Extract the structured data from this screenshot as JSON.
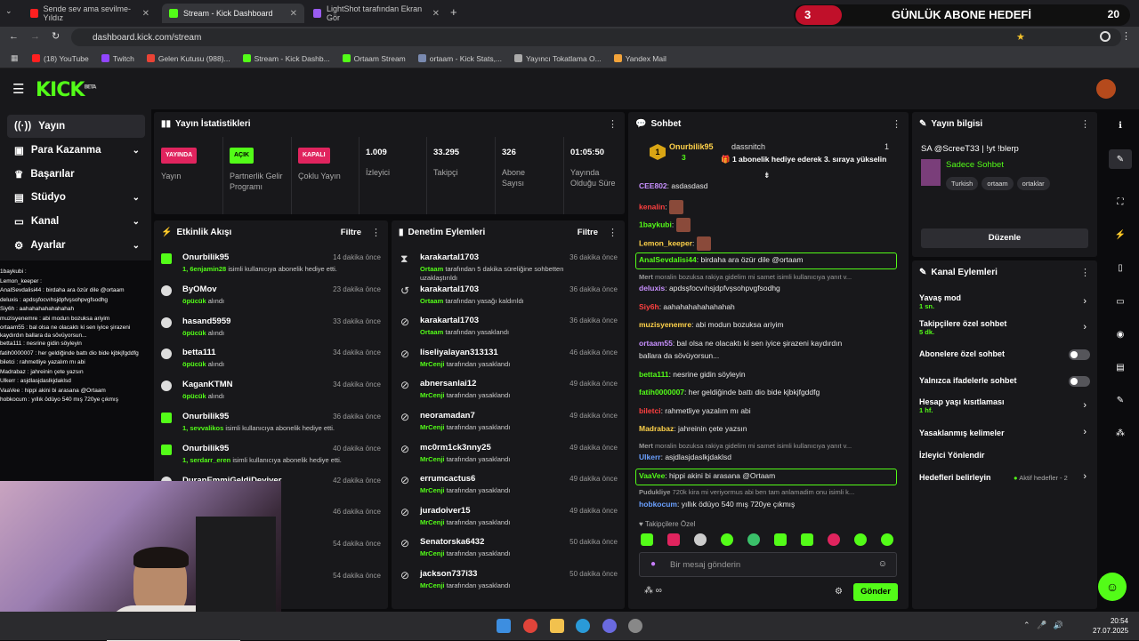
{
  "browser": {
    "tabs": [
      {
        "label": "Sende sev ama sevilme- Yıldız",
        "active": false
      },
      {
        "label": "Stream - Kick Dashboard",
        "active": true
      },
      {
        "label": "LightShot tarafından Ekran Gör",
        "active": false
      }
    ],
    "url": "dashboard.kick.com/stream",
    "bookmarks": [
      "(18) YouTube",
      "Twitch",
      "Gelen Kutusu (988)...",
      "Stream - Kick Dashb...",
      "Ortaam Stream",
      "ortaam - Kick Stats,...",
      "Yayıncı Tokatlama O...",
      "Yandex Mail"
    ]
  },
  "sub_goal": {
    "count": "3",
    "label": "GÜNLÜK ABONE HEDEFİ",
    "target": "20"
  },
  "kick": {
    "logo": "KICK",
    "beta": "BETA"
  },
  "sidebar": {
    "items": [
      {
        "label": "Yayın",
        "icon": "broadcast-icon"
      },
      {
        "label": "Para Kazanma",
        "icon": "money-icon"
      },
      {
        "label": "Başarılar",
        "icon": "trophy-icon"
      },
      {
        "label": "Stüdyo",
        "icon": "studio-icon"
      },
      {
        "label": "Kanal",
        "icon": "channel-icon"
      },
      {
        "label": "Ayarlar",
        "icon": "gear-icon"
      }
    ]
  },
  "overlay_chat": [
    "1baykubi :",
    "Lemon_keeper :",
    "AnalSevdalisi44 : birdaha ara özür dile @ortaam",
    "deluxis : apdsşfocvıhsjdpfvşsohpvgfsodhg",
    "Siy6h : aahahahahahahahah",
    "muzisyenemre : abi modun bozuksa ariyim",
    "ortaam55 : bal olsa ne olacaktı ki sen iyice şirazeni kaydırdın ballara da sövüyorsun...",
    "betta111 : nesrine gidin söyleyin",
    "fatih0000007 : her geldiğinde battı dio bide kjbkjfgddfg",
    "biletci : rahmetliye yazalım mı abi",
    "Madrabaz : jahreinin çete yazsın",
    "Ulkerr : asjdlasjdaslkjdaklsd",
    "VaaVee : hippi akini bi arasana @Ortaam",
    "hobkocum : yıllık ödüyo 540 mış 720ye çıkmış"
  ],
  "stats": {
    "title": "Yayın İstatistikleri",
    "yayin": {
      "badge": "YAYINDA",
      "label": "Yayın"
    },
    "partner": {
      "badge": "AÇIK",
      "label": "Partnerlik Gelir Programı"
    },
    "coklu": {
      "badge": "KAPALI",
      "label": "Çoklu Yayın"
    },
    "izleyici": {
      "value": "1.009",
      "label": "İzleyici"
    },
    "takipci": {
      "value": "33.295",
      "label": "Takipçi"
    },
    "abone": {
      "value": "326",
      "label": "Abone Sayısı"
    },
    "sure": {
      "value": "01:05:50",
      "label": "Yayında Olduğu Süre"
    }
  },
  "activity": {
    "title": "Etkinlik Akışı",
    "filter": "Filtre",
    "rows": [
      {
        "name": "Onurbilik95",
        "time": "14 dakika önce",
        "count": "1,",
        "user": "6enjamin28",
        "rest": "isimli kullanıcıya abonelik hediye etti."
      },
      {
        "name": "ByOMov",
        "time": "23 dakika önce",
        "user": "öpücük",
        "rest": "alındı"
      },
      {
        "name": "hasand5959",
        "time": "33 dakika önce",
        "user": "öpücük",
        "rest": "alındı"
      },
      {
        "name": "betta111",
        "time": "34 dakika önce",
        "user": "öpücük",
        "rest": "alındı"
      },
      {
        "name": "KaganKTMN",
        "time": "34 dakika önce",
        "user": "öpücük",
        "rest": "alındı"
      },
      {
        "name": "Onurbilik95",
        "time": "36 dakika önce",
        "count": "1,",
        "user": "sevvalikos",
        "rest": "isimli kullanıcıya abonelik hediye etti."
      },
      {
        "name": "Onurbilik95",
        "time": "40 dakika önce",
        "count": "1,",
        "user": "serdarr_eren",
        "rest": "isimli kullanıcıya abonelik hediye etti."
      },
      {
        "name": "DuranEmmiGeldiDeviver",
        "time": "42 dakika önce",
        "user": "",
        "rest": ""
      },
      {
        "name": "",
        "time": "46 dakika önce",
        "user": "",
        "rest": ""
      },
      {
        "name": "",
        "time": "54 dakika önce",
        "user": "",
        "rest": ""
      },
      {
        "name": "",
        "time": "54 dakika önce",
        "user": "",
        "rest": ""
      }
    ]
  },
  "moderation": {
    "title": "Denetim Eylemleri",
    "filter": "Filtre",
    "rows": [
      {
        "name": "karakartal1703",
        "time": "36 dakika önce",
        "mod": "Ortaam",
        "rest": "tarafından 5 dakika süreliğine sohbetten uzaklaştırıldı"
      },
      {
        "name": "karakartal1703",
        "time": "36 dakika önce",
        "mod": "Ortaam",
        "rest": "tarafından yasağı kaldırıldı"
      },
      {
        "name": "karakartal1703",
        "time": "36 dakika önce",
        "mod": "Ortaam",
        "rest": "tarafından yasaklandı"
      },
      {
        "name": "liseliyalayan313131",
        "time": "46 dakika önce",
        "mod": "MrCenji",
        "rest": "tarafından yasaklandı"
      },
      {
        "name": "abnersanlai12",
        "time": "49 dakika önce",
        "mod": "MrCenji",
        "rest": "tarafından yasaklandı"
      },
      {
        "name": "neoramadan7",
        "time": "49 dakika önce",
        "mod": "MrCenji",
        "rest": "tarafından yasaklandı"
      },
      {
        "name": "mc0rm1ck3nny25",
        "time": "49 dakika önce",
        "mod": "MrCenji",
        "rest": "tarafından yasaklandı"
      },
      {
        "name": "errumcactus6",
        "time": "49 dakika önce",
        "mod": "MrCenji",
        "rest": "tarafından yasaklandı"
      },
      {
        "name": "juradoiver15",
        "time": "49 dakika önce",
        "mod": "MrCenji",
        "rest": "tarafından yasaklandı"
      },
      {
        "name": "Senatorska6432",
        "time": "50 dakika önce",
        "mod": "MrCenji",
        "rest": "tarafından yasaklandı"
      },
      {
        "name": "jackson737i33",
        "time": "50 dakika önce",
        "mod": "MrCenji",
        "rest": "tarafından yasaklandı"
      }
    ]
  },
  "chat": {
    "title": "Sohbet",
    "pinned": {
      "rank": "1",
      "user": "Onurbilik95",
      "subs": "3",
      "user2": "dassnitch",
      "count": "1",
      "text": "1 abonelik hediye ederek 3. sıraya yükselin"
    },
    "messages": [
      {
        "user": "CEE802",
        "color": "#c890ff",
        "text": "asdasdasd"
      },
      {
        "user": "kenalin",
        "color": "#ff4040",
        "text": ""
      },
      {
        "user": "1baykubi",
        "color": "#53fc18",
        "text": ""
      },
      {
        "user": "Lemon_keeper",
        "color": "#ffd24a",
        "text": ""
      },
      {
        "user": "AnalSevdalisi44",
        "color": "#53fc18",
        "text": "birdaha ara özür dile @ortaam"
      },
      {
        "user": "Mert",
        "color": "#999999",
        "text": "moralin bozuksa rakiya gidelim mi samet isimli kullanıcıya yanıt v..."
      },
      {
        "user": "deluxis",
        "color": "#c890ff",
        "text": "apdsşfocvıhsjdpfvşsohpvgfsodhg"
      },
      {
        "user": "Siy6h",
        "color": "#ff4040",
        "text": "aahahahahahahahah"
      },
      {
        "user": "muzisyenemre",
        "color": "#ffd24a",
        "text": "abi modun bozuksa ariyim"
      },
      {
        "user": "ortaam55",
        "color": "#c890ff",
        "text": "bal olsa ne olacaktı ki sen iyice şirazeni kaydırdın"
      },
      {
        "user": "",
        "color": "#e8e8e8",
        "text": "ballara da sövüyorsun..."
      },
      {
        "user": "betta111",
        "color": "#53fc18",
        "text": "nesrine gidin söyleyin"
      },
      {
        "user": "fatih0000007",
        "color": "#53fc18",
        "text": "her geldiğinde battı dio bide kjbkjfgddfg"
      },
      {
        "user": "biletci",
        "color": "#ff4040",
        "text": "rahmetliye yazalım mı abi"
      },
      {
        "user": "Madrabaz",
        "color": "#ffd24a",
        "text": "jahreinin çete yazsın"
      },
      {
        "user": "Mert",
        "color": "#999999",
        "text": "moralin bozuksa rakiya gidelim mi samet isimli kullanıcıya yanıt v..."
      },
      {
        "user": "Ulkerr",
        "color": "#6aa0ff",
        "text": "asjdlasjdaslkjdaklsd"
      },
      {
        "user": "VaaVee",
        "color": "#53fc18",
        "text": "hippi akini bi arasana @Ortaam"
      },
      {
        "user": "Pudukliye",
        "color": "#999999",
        "text": "720k kira mi veriyormus abi ben tam anlamadim onu isimli k..."
      },
      {
        "user": "hobkocum",
        "color": "#6aa0ff",
        "text": "yıllık ödüyo 540 mış 720ye çıkmış"
      }
    ],
    "emote_section": "Takipçilere Özel",
    "placeholder": "Bir mesaj gönderin",
    "send": "Gönder"
  },
  "stream_info": {
    "title": "Yayın bilgisi",
    "stream_title": "SA @ScreeT33 | !yt !blerp",
    "category": "Sadece Sohbet",
    "tags": [
      "Turkish",
      "ortaam",
      "ortaklar"
    ],
    "edit": "Düzenle"
  },
  "channel_actions": {
    "title": "Kanal Eylemleri",
    "items": [
      {
        "label": "Yavaş mod",
        "sub": "1 sn.",
        "control": "chevron"
      },
      {
        "label": "Takipçilere özel sohbet",
        "sub": "5 dk.",
        "control": "chevron"
      },
      {
        "label": "Abonelere özel sohbet",
        "sub": "",
        "control": "toggle"
      },
      {
        "label": "Yalnızca ifadelerle sohbet",
        "sub": "",
        "control": "toggle"
      },
      {
        "label": "Hesap yaşı kısıtlaması",
        "sub": "1 hf.",
        "control": "chevron"
      },
      {
        "label": "Yasaklanmış kelimeler",
        "sub": "",
        "control": "chevron"
      },
      {
        "label": "İzleyici Yönlendir",
        "sub": "",
        "control": "none"
      },
      {
        "label": "Hedefleri belirleyin",
        "sub": "",
        "control": "chevron"
      }
    ],
    "goals_status": "Aktif hedefler - 2"
  },
  "taskbar": {
    "time": "20:54",
    "date": "27.07.2025"
  },
  "colors": {
    "accent": "#53fc18",
    "bg": "#0b0b0d",
    "panel": "#18181b",
    "danger": "#e0245e"
  }
}
